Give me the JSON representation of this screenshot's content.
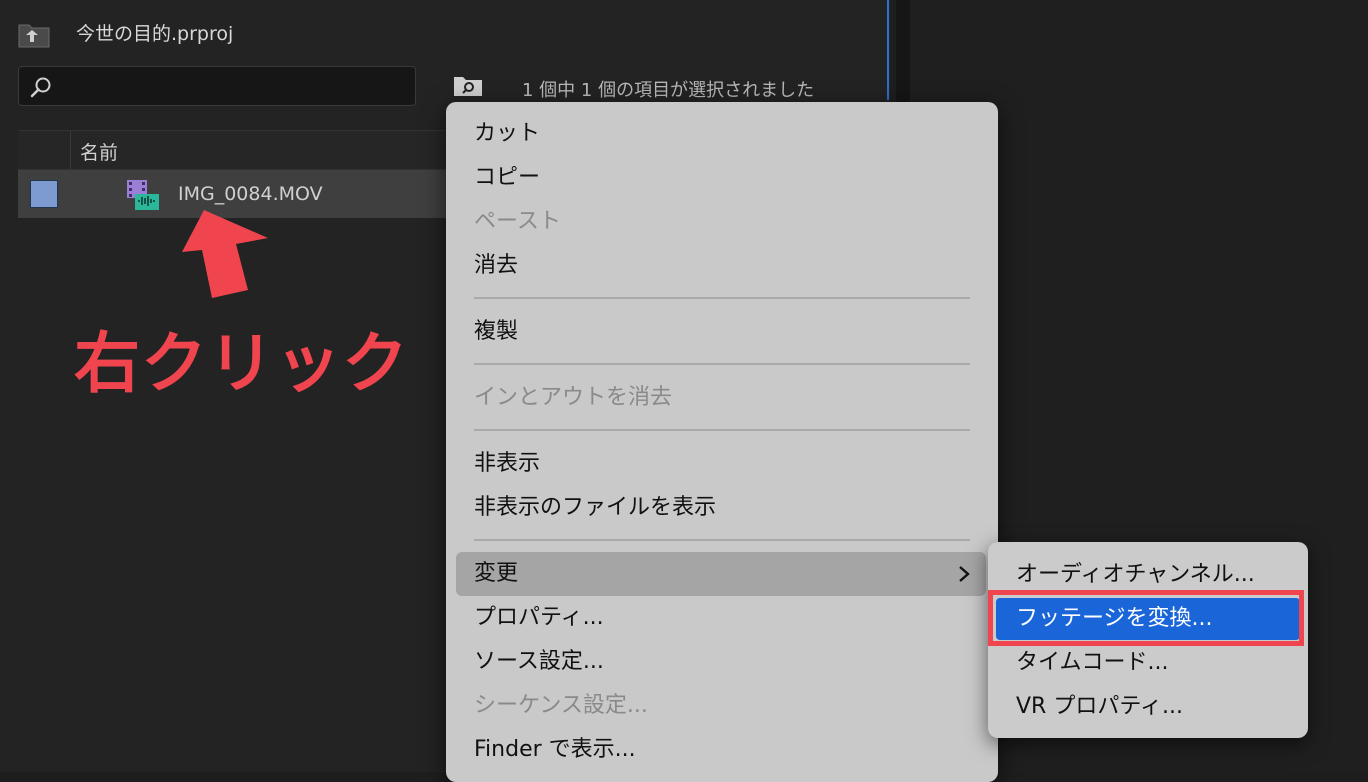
{
  "project": {
    "title": "今世の目的.prproj",
    "search_placeholder": "",
    "selection_status": "1 個中 1 個の項目が選択されました",
    "column_name": "名前"
  },
  "clip": {
    "name": "IMG_0084.MOV",
    "label_color": "#7d9ad1"
  },
  "annotation": {
    "text": "右クリック",
    "color": "#f0454e"
  },
  "context_menu": {
    "items": [
      {
        "label": "カット",
        "enabled": true
      },
      {
        "label": "コピー",
        "enabled": true
      },
      {
        "label": "ペースト",
        "enabled": false
      },
      {
        "label": "消去",
        "enabled": true
      },
      {
        "label": "複製",
        "enabled": true
      },
      {
        "label": "インとアウトを消去",
        "enabled": false
      },
      {
        "label": "非表示",
        "enabled": true
      },
      {
        "label": "非表示のファイルを表示",
        "enabled": true
      },
      {
        "label": "変更",
        "enabled": true,
        "has_submenu": true,
        "hovered": true
      },
      {
        "label": "プロパティ...",
        "enabled": true
      },
      {
        "label": "ソース設定...",
        "enabled": true
      },
      {
        "label": "シーケンス設定...",
        "enabled": false
      },
      {
        "label": "Finder で表示...",
        "enabled": true
      }
    ]
  },
  "submenu": {
    "items": [
      {
        "label": "オーディオチャンネル..."
      },
      {
        "label": "フッテージを変換...",
        "selected": true
      },
      {
        "label": "タイムコード..."
      },
      {
        "label": "VR プロパティ..."
      }
    ]
  },
  "colors": {
    "selection_blue": "#1a66d8",
    "panel_divider": "#2d6fd1"
  }
}
